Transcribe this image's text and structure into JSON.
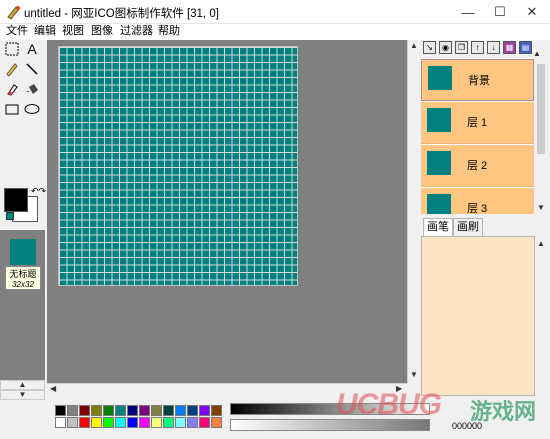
{
  "window": {
    "title": "untitled  - 网亚ICO图标制作软件 [31, 0]",
    "controls": {
      "minimize": "—",
      "maximize": "☐",
      "close": "✕"
    }
  },
  "menu": [
    "文件",
    "编辑",
    "视图",
    "图像",
    "过滤器",
    "帮助"
  ],
  "tools": [
    {
      "name": "select-rect",
      "glyph": "⬚"
    },
    {
      "name": "text",
      "glyph": "A"
    },
    {
      "name": "pencil",
      "glyph": "✎"
    },
    {
      "name": "line",
      "glyph": "╲"
    },
    {
      "name": "eraser",
      "glyph": "✐"
    },
    {
      "name": "fill",
      "glyph": "⬙"
    },
    {
      "name": "rectangle",
      "glyph": "▭"
    },
    {
      "name": "ellipse",
      "glyph": "◯"
    }
  ],
  "colors": {
    "foreground": "#000000",
    "background": "#ffffff",
    "accent": "#008080",
    "layer_bg": "#ffc682",
    "brush_bg": "#ffe3c7"
  },
  "icon_list": {
    "name": "无标题",
    "size": "32x32"
  },
  "layers": [
    {
      "name": "背景",
      "selected": true
    },
    {
      "name": "层 1",
      "selected": false
    },
    {
      "name": "层 2",
      "selected": false
    },
    {
      "name": "层 3",
      "selected": false
    }
  ],
  "tabs": [
    "画笔",
    "画刷"
  ],
  "palette_row1": [
    "#000000",
    "#808080",
    "#800000",
    "#808000",
    "#008000",
    "#008080",
    "#000080",
    "#800080",
    "#808040",
    "#004040",
    "#0080ff",
    "#004080",
    "#8000ff",
    "#804000"
  ],
  "palette_row2": [
    "#ffffff",
    "#c0c0c0",
    "#ff0000",
    "#ffff00",
    "#00ff00",
    "#00ffff",
    "#0000ff",
    "#ff00ff",
    "#ffff80",
    "#00ff80",
    "#80ffff",
    "#8080ff",
    "#ff0080",
    "#ff8040"
  ],
  "hex_value": "000000",
  "watermark": {
    "text1": "UCBUG",
    "text2": "游戏网"
  }
}
